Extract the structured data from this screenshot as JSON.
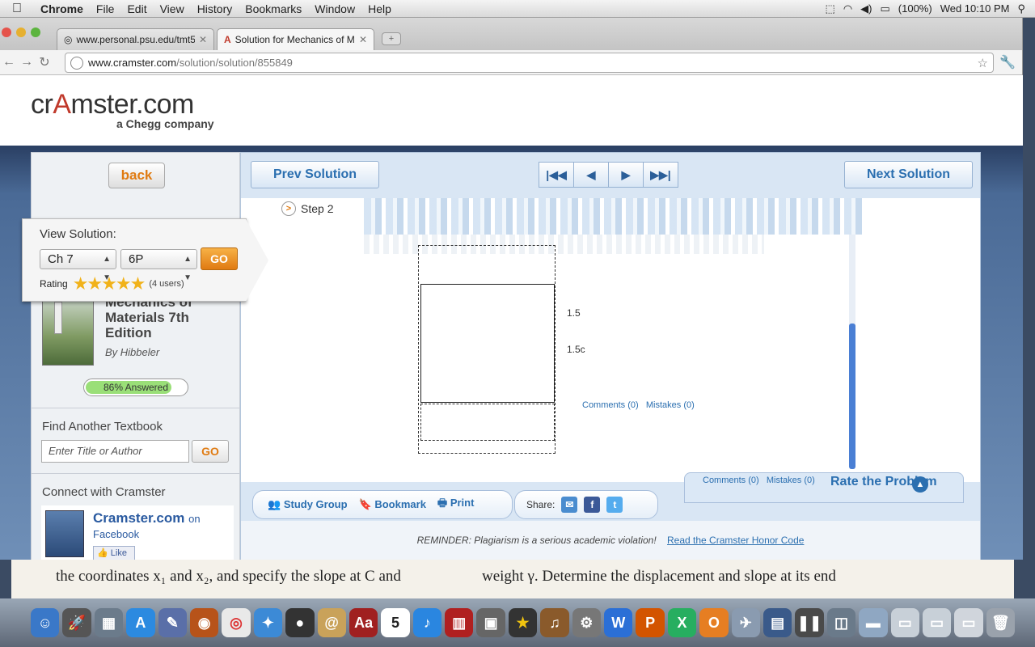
{
  "menubar": {
    "app": "Chrome",
    "items": [
      "File",
      "Edit",
      "View",
      "History",
      "Bookmarks",
      "Window",
      "Help"
    ],
    "battery": "(100%)",
    "clock": "Wed 10:10 PM"
  },
  "browser": {
    "tabs": [
      {
        "title": "www.personal.psu.edu/tmt5",
        "active": false
      },
      {
        "title": "Solution for Mechanics of Ma",
        "active": true
      }
    ],
    "url_host": "www.cramster.com",
    "url_path": "/solution/solution/855849"
  },
  "site": {
    "logo_main_prefix": "cr",
    "logo_main_A": "A",
    "logo_main_suffix": "mster.com",
    "logo_sub": "a Chegg company"
  },
  "sidebar": {
    "back_label": "back",
    "view_solution_title": "View Solution:",
    "chapter_select": "Ch 7",
    "problem_select": "6P",
    "go_label": "GO",
    "rating_label": "Rating",
    "rating_stars": 4.5,
    "rating_users": "(4 users)",
    "book_title": "Mechanics of Materials 7th Edition",
    "book_author": "By Hibbeler",
    "answered_percent": 86,
    "answered_label": "86% Answered",
    "find_title": "Find Another Textbook",
    "find_placeholder": "Enter Title or Author",
    "find_go": "GO",
    "connect_title": "Connect with Cramster",
    "fb_name": "Cramster.com",
    "fb_on": "on",
    "fb_sub": "Facebook",
    "fb_like": "Like"
  },
  "content": {
    "prev_label": "Prev Solution",
    "next_label": "Next Solution",
    "pager": [
      "|◀◀",
      "◀",
      "▶",
      "▶▶|"
    ],
    "step_label": "Step 2",
    "dims": [
      "1.5",
      "1.5c"
    ],
    "comments_text": "Comments (0)",
    "mistakes_text": "Mistakes (0)",
    "rate_title": "Rate the Problem",
    "actions": [
      "Study Group",
      "Bookmark",
      "Print"
    ],
    "share_label": "Share:",
    "reminder": "REMINDER: Plagiarism is a serious academic violation!",
    "honor_link": "Read the Cramster Honor Code"
  },
  "doc_peek": {
    "left": "the coordinates x₁ and x₂, and specify the slope at C and",
    "right": "weight γ. Determine the displacement and slope at its end"
  },
  "colors": {
    "accent_orange": "#e07b12",
    "link_blue": "#2b6fb0",
    "progress_green": "#9adf78"
  }
}
